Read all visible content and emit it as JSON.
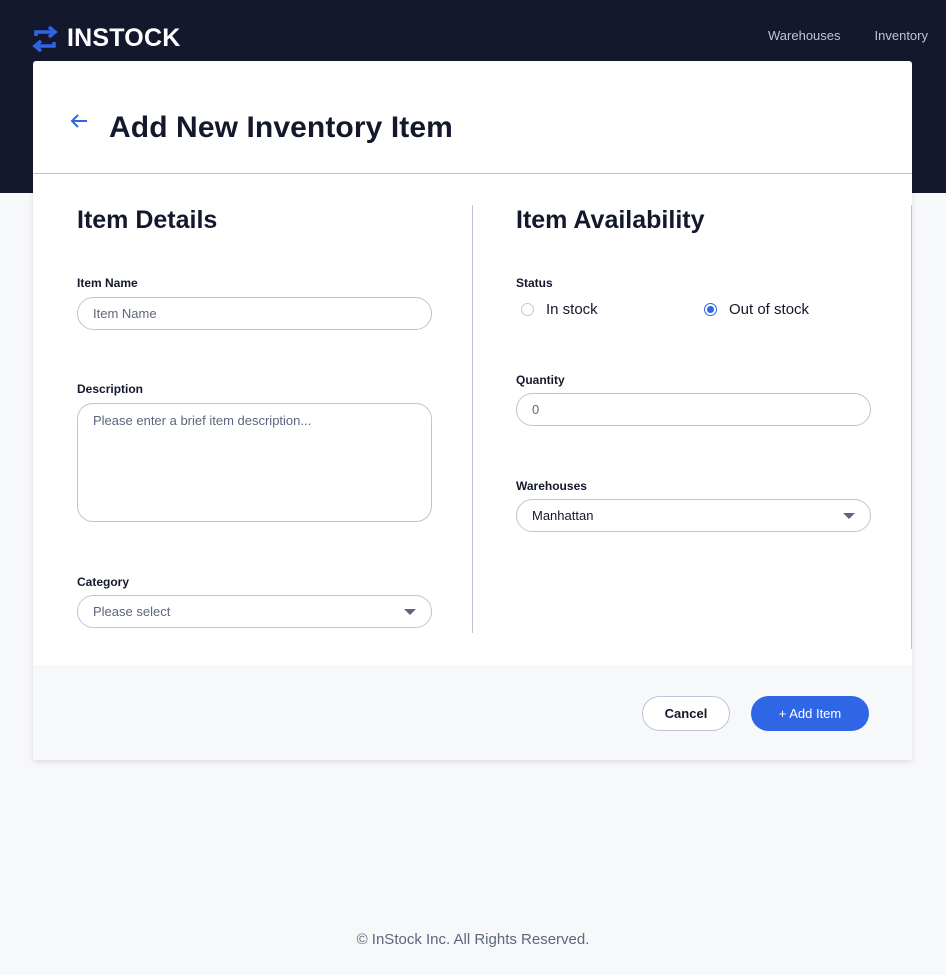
{
  "app": {
    "logo_text": "INSTOCK",
    "nav": [
      "Warehouses",
      "Inventory"
    ]
  },
  "page": {
    "title": "Add New Inventory Item"
  },
  "details": {
    "title": "Item Details",
    "item_name_label": "Item Name",
    "item_name_placeholder": "Item Name",
    "item_name_value": "",
    "description_label": "Description",
    "description_placeholder": "Please enter a brief item description...",
    "description_value": "",
    "category_label": "Category",
    "category_selected": "Please select"
  },
  "availability": {
    "title": "Item Availability",
    "status_label": "Status",
    "status_options": [
      "In stock",
      "Out of stock"
    ],
    "status_selected": "Out of stock",
    "quantity_label": "Quantity",
    "quantity_value": "0",
    "warehouses_label": "Warehouses",
    "warehouse_selected": "Manhattan"
  },
  "actions": {
    "cancel_label": "Cancel",
    "add_label": "+ Add Item"
  },
  "footer": {
    "copyright": "© InStock Inc. All Rights Reserved."
  },
  "colors": {
    "header_bg": "#13182c",
    "accent": "#2e66e6",
    "border": "#bdc5d5",
    "page_bg": "#f7f8fa"
  },
  "icons": {
    "logo": "swap-arrows-icon",
    "back": "arrow-left-icon",
    "dropdown": "caret-down-icon"
  }
}
